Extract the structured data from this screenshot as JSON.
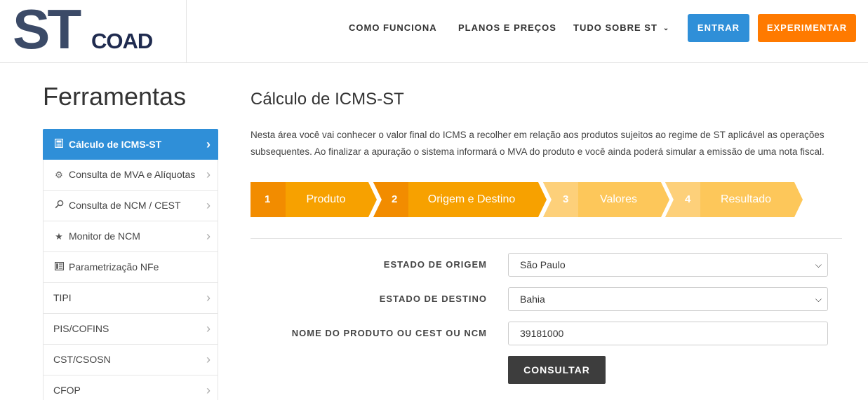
{
  "header": {
    "logo_st": "ST",
    "logo_coad": "COAD",
    "nav": [
      "COMO FUNCIONA",
      "PLANOS E PREÇOS",
      "TUDO SOBRE ST"
    ],
    "btn_entrar": "ENTRAR",
    "btn_experimentar": "EXPERIMENTAR",
    "colors": {
      "entrar": "#2f8fd8",
      "experimentar": "#ff7a00"
    }
  },
  "sidebar": {
    "title": "Ferramentas",
    "items": [
      {
        "label": "Cálculo de ICMS-ST",
        "icon": "calculator-icon",
        "active": true
      },
      {
        "label": "Consulta de MVA e Alíquotas",
        "icon": "gear-icon"
      },
      {
        "label": "Consulta de NCM / CEST",
        "icon": "search-icon"
      },
      {
        "label": "Monitor de NCM",
        "icon": "star-icon"
      },
      {
        "label": "Parametrização NFe",
        "icon": "document-icon"
      },
      {
        "label": "TIPI"
      },
      {
        "label": "PIS/COFINS"
      },
      {
        "label": "CST/CSOSN"
      },
      {
        "label": "CFOP"
      }
    ]
  },
  "main": {
    "title": "Cálculo de ICMS-ST",
    "description": "Nesta área você vai conhecer o valor final do ICMS a recolher em relação aos produtos sujeitos ao regime de ST aplicável as operações subsequentes. Ao finalizar a apuração o sistema informará o MVA do produto e você ainda poderá simular a emissão de uma nota fiscal.",
    "steps": [
      {
        "num": "1",
        "label": "Produto",
        "state": "done"
      },
      {
        "num": "2",
        "label": "Origem e Destino",
        "state": "current"
      },
      {
        "num": "3",
        "label": "Valores",
        "state": "pending"
      },
      {
        "num": "4",
        "label": "Resultado",
        "state": "pending"
      }
    ],
    "step_colors": {
      "done": "#f7a100",
      "done_dark": "#f28c00",
      "pending": "#fdc75a",
      "pending_dark": "#fdd07a"
    },
    "form": {
      "origem_label": "ESTADO DE ORIGEM",
      "origem_value": "São Paulo",
      "destino_label": "ESTADO DE DESTINO",
      "destino_value": "Bahia",
      "produto_label": "NOME DO PRODUTO OU CEST OU NCM",
      "produto_value": "39181000",
      "submit": "CONSULTAR"
    }
  }
}
